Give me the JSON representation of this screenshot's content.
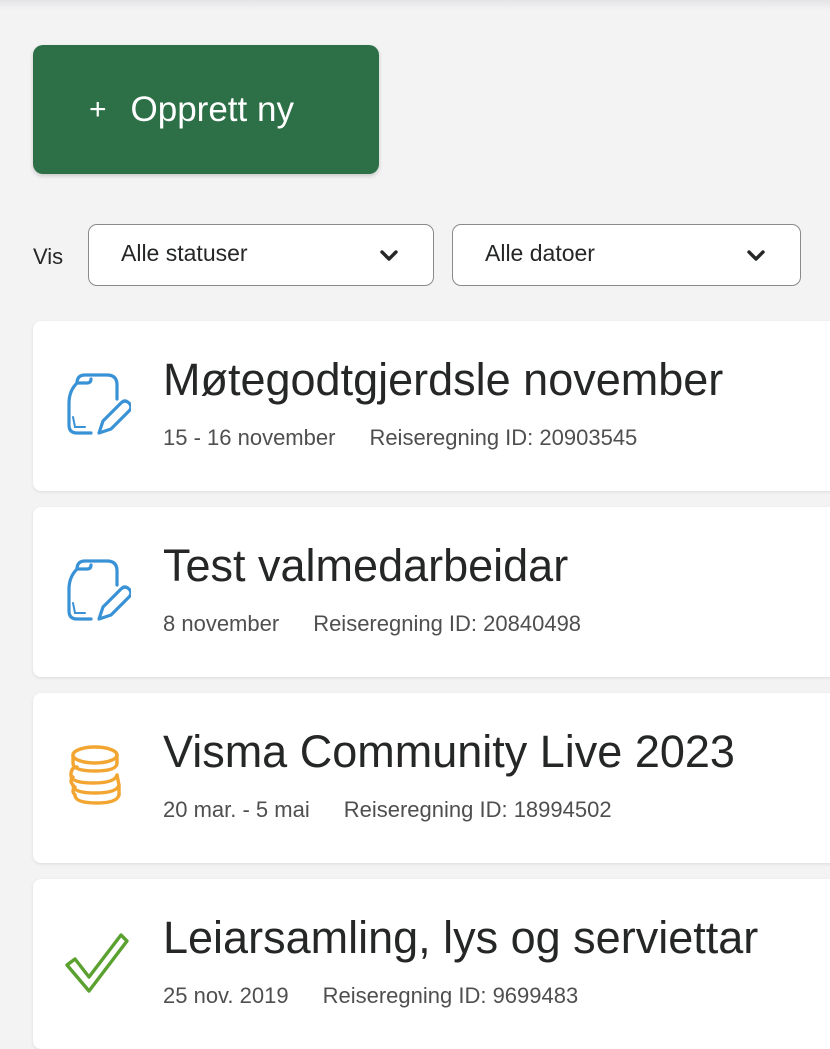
{
  "create_button": {
    "plus": "+",
    "label": "Opprett ny"
  },
  "filters": {
    "label": "Vis",
    "status_select": {
      "value": "Alle statuser",
      "icon": "chevron-down-icon"
    },
    "date_select": {
      "value": "Alle datoer",
      "icon": "chevron-down-icon"
    }
  },
  "expenses": [
    {
      "title": "Møtegodtgjerdsle november",
      "date": "15 - 16 november",
      "id_text": "Reiseregning ID: 20903545",
      "status_icon": "draft-edit-icon",
      "icon_color": "#3a92d6"
    },
    {
      "title": "Test valmedarbeidar",
      "date": "8 november",
      "id_text": "Reiseregning ID: 20840498",
      "status_icon": "draft-edit-icon",
      "icon_color": "#3a92d6"
    },
    {
      "title": "Visma Community Live 2023",
      "date": "20 mar. - 5 mai",
      "id_text": "Reiseregning ID: 18994502",
      "status_icon": "coins-icon",
      "icon_color": "#f2a531"
    },
    {
      "title": "Leiarsamling, lys og serviettar",
      "date": "25 nov. 2019",
      "id_text": "Reiseregning ID: 9699483",
      "status_icon": "checkmark-icon",
      "icon_color": "#5aa12f"
    }
  ],
  "colors": {
    "primary_button": "#2d7048",
    "background": "#f3f3f4"
  }
}
